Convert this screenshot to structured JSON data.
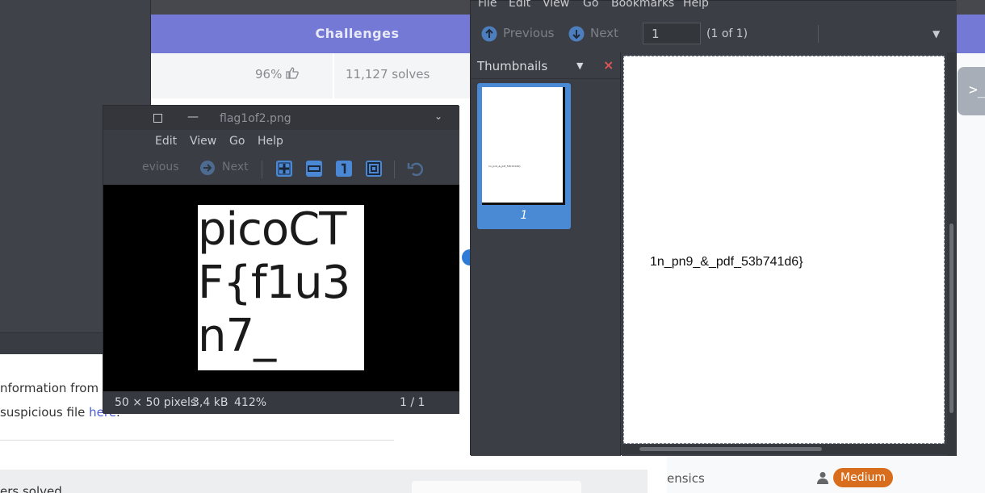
{
  "web": {
    "header_title": "Challenges",
    "rating": "96%",
    "solves": "11,127 solves",
    "desc_line1": "nformation from",
    "desc_line2_prefix": "suspicious file ",
    "desc_link": "here",
    "desc_suffix": ".",
    "users_solved": "ers solved",
    "tag_category": "ensics",
    "difficulty_badge": "Medium",
    "terminal_label": ">_"
  },
  "image_viewer": {
    "title": "flag1of2.png",
    "menu": [
      "Edit",
      "View",
      "Go",
      "Help"
    ],
    "toolbar": {
      "previous_label": "evious",
      "next_label": "Next"
    },
    "image_text_lines": [
      "picoCT",
      "F{f1u3",
      "n7_"
    ],
    "status": {
      "dimensions": "50 × 50 pixels",
      "size": "3,4 kB",
      "zoom": "412%",
      "position": "1 / 1"
    }
  },
  "doc_viewer": {
    "menu": [
      "File",
      "Edit",
      "View",
      "Go",
      "Bookmarks",
      "Help"
    ],
    "toolbar": {
      "previous_label": "Previous",
      "next_label": "Next",
      "page_value": "1",
      "page_count": "(1 of 1)"
    },
    "sidebar": {
      "title": "Thumbnails",
      "thumb_label": "1",
      "close_glyph": "×"
    },
    "page_text": "1n_pn9_&_pdf_53b741d6}"
  }
}
